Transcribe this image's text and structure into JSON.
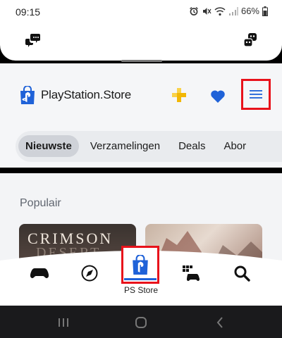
{
  "status_bar": {
    "time": "09:15",
    "battery": "66%"
  },
  "header": {
    "brand": "PlayStation.Store",
    "icons": [
      "playstation-plus-icon",
      "heart-icon",
      "menu-icon"
    ],
    "accent_color": "#1f62d8",
    "highlight_color": "#e8121b"
  },
  "tabs": [
    {
      "label": "Nieuwste",
      "active": true
    },
    {
      "label": "Verzamelingen",
      "active": false
    },
    {
      "label": "Deals",
      "active": false
    },
    {
      "label": "Abor",
      "active": false
    }
  ],
  "section": {
    "title": "Populair"
  },
  "cards": [
    {
      "title_line1": "CRIMSON",
      "title_line2": "DESERT"
    },
    {}
  ],
  "bottom_nav": {
    "active_label": "PS Store",
    "items": [
      "games-icon",
      "explore-icon",
      "ps-store-icon",
      "game-base-icon",
      "search-icon"
    ]
  }
}
